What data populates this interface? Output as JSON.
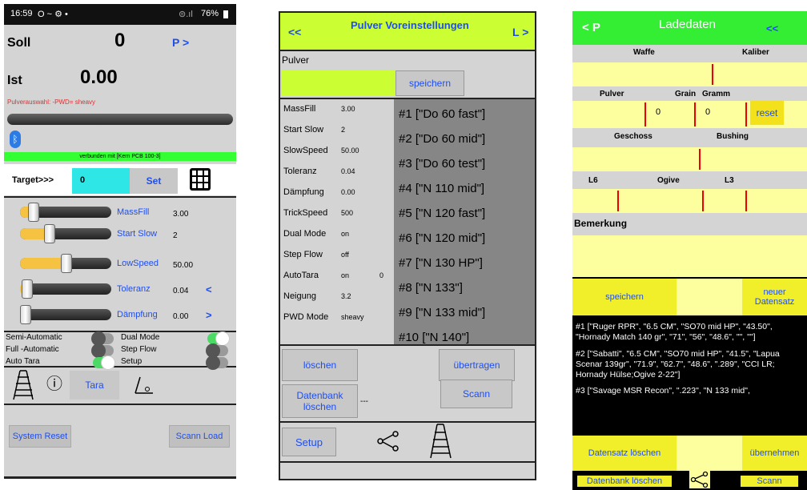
{
  "s1": {
    "status": {
      "time": "16:59",
      "icons_left": "O ~ ⚙ •",
      "battery": "76%"
    },
    "soll_label": "Soll",
    "soll_value": "0",
    "p_next": "P >",
    "ist_label": "Ist",
    "ist_value": "0.00",
    "powder_select": "Pulverauswahl: -PWD= sheavy",
    "connected": "verbunden mit [Kern PCB 100-3]",
    "target_label": "Target>>>",
    "target_value": "0",
    "set_label": "Set",
    "sliders": [
      {
        "label": "MassFill",
        "value": "3.00",
        "arrow": "",
        "fill": 0.12
      },
      {
        "label": "Start Slow",
        "value": "2",
        "arrow": "",
        "fill": 0.3
      },
      {
        "label": "LowSpeed",
        "value": "50.00",
        "arrow": "",
        "fill": 0.48
      },
      {
        "label": "Toleranz",
        "value": "0.04",
        "arrow": "<",
        "fill": 0.05
      },
      {
        "label": "Dämpfung",
        "value": "0.00",
        "arrow": ">",
        "fill": 0.0
      }
    ],
    "toggles": [
      {
        "left_label": "Semi-Automatic",
        "left_on": false,
        "right_label": "Dual Mode",
        "right_on": true
      },
      {
        "left_label": "Full -Automatic",
        "left_on": false,
        "right_label": "Step Flow",
        "right_on": false
      },
      {
        "left_label": "Auto Tara",
        "left_on": true,
        "right_label": "Setup",
        "right_on": false
      }
    ],
    "info_icon": "ⓘ",
    "tara_label": "Tara",
    "system_reset": "System Reset",
    "scann_load": "Scann Load"
  },
  "s2": {
    "back": "<<",
    "title": "Pulver Voreinstellungen",
    "forward": "L >",
    "pulver_label": "Pulver",
    "pulver_input": "",
    "speichern": "speichern",
    "params": [
      {
        "label": "MassFill",
        "value": "3.00",
        "extra": ""
      },
      {
        "label": "Start Slow",
        "value": "2",
        "extra": ""
      },
      {
        "label": "SlowSpeed",
        "value": "50.00",
        "extra": ""
      },
      {
        "label": "Toleranz",
        "value": "0.04",
        "extra": ""
      },
      {
        "label": "Dämpfung",
        "value": "0.00",
        "extra": ""
      },
      {
        "label": "TrickSpeed",
        "value": "500",
        "extra": ""
      },
      {
        "label": "Dual Mode",
        "value": "on",
        "extra": ""
      },
      {
        "label": "Step Flow",
        "value": "off",
        "extra": ""
      },
      {
        "label": "AutoTara",
        "value": "on",
        "extra": "0"
      },
      {
        "label": "Neigung",
        "value": "3.2",
        "extra": ""
      },
      {
        "label": "PWD Mode",
        "value": "sheavy",
        "extra": ""
      }
    ],
    "list": [
      "#1   [\"Do 60 fast\"]",
      "#2   [\"Do 60 mid\"]",
      "#3   [\"Do 60 test\"]",
      "#4   [\"N 110 mid\"]",
      "#5   [\"N 120 fast\"]",
      "#6   [\"N 120 mid\"]",
      "#7   [\"N 130 HP\"]",
      "#8   [\"N 133\"]",
      "#9   [\"N 133 mid\"]",
      "#10   [\"N 140\"]"
    ],
    "loeschen": "löschen",
    "uebertragen": "übertragen",
    "db_loeschen": "Datenbank löschen",
    "dashes": "---",
    "scann": "Scann",
    "setup": "Setup"
  },
  "s3": {
    "back": "< P",
    "title": "Ladedaten",
    "forward": "<<",
    "waffe": "Waffe",
    "kaliber": "Kaliber",
    "pulver": "Pulver",
    "grain": "Grain",
    "gramm": "Gramm",
    "grain_val": "0",
    "gramm_val": "0",
    "reset": "reset",
    "geschoss": "Geschoss",
    "bushing": "Bushing",
    "l6": "L6",
    "ogive": "Ogive",
    "l3": "L3",
    "bemerkung": "Bemerkung",
    "speichern": "speichern",
    "neuer": "neuer Datensatz",
    "records": [
      "#1   [\"Ruger RPR\", \"6.5 CM\", \"SO70 mid HP\", \"43.50\", \"Hornady Match 140 gr\", \"71\", \"56\", \"48.6\", \"\", \"\"]",
      "#2   [\"Sabatti\", \"6.5 CM\", \"SO70 mid HP\", \"41.5\", \"Lapua Scenar 139gr\", \"71.9\", \"62.7\", \"48.6\", \".289\", \"CCI LR; Hornady Hülse;Ogive 2-22\"]",
      "#3   [\"Savage MSR Recon\", \".223\", \"N 133 mid\","
    ],
    "ds_loeschen": "Datensatz löschen",
    "uebernehmen": "übernehmen",
    "db_loeschen": "Datenbank löschen",
    "scann": "Scann"
  }
}
